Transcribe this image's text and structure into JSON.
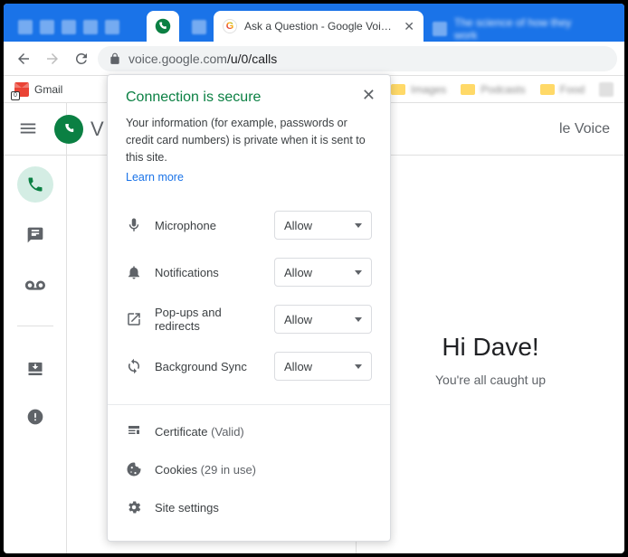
{
  "tabs": {
    "active_title": "",
    "tab2_title": "Ask a Question - Google Voice H",
    "tab3_title": "The science of how they work"
  },
  "url": {
    "host": "voice.google.com",
    "path": "/u/0/calls"
  },
  "bookmarks": {
    "gmail": "Gmail",
    "gmail_badge": "0",
    "folder1": "Images",
    "folder2": "Podcasts",
    "folder3": "Food"
  },
  "app": {
    "product_partial": "le Voice",
    "greeting": "Hi Dave!",
    "subtext": "You're all caught up"
  },
  "popup": {
    "title": "Connection is secure",
    "description": "Your information (for example, passwords or credit card numbers) is private when it is sent to this site.",
    "learn_more": "Learn more",
    "permissions": [
      {
        "label": "Microphone",
        "value": "Allow"
      },
      {
        "label": "Notifications",
        "value": "Allow"
      },
      {
        "label": "Pop-ups and redirects",
        "value": "Allow"
      },
      {
        "label": "Background Sync",
        "value": "Allow"
      }
    ],
    "certificate_label": "Certificate",
    "certificate_status": "(Valid)",
    "cookies_label": "Cookies",
    "cookies_count": "(29 in use)",
    "site_settings": "Site settings"
  }
}
